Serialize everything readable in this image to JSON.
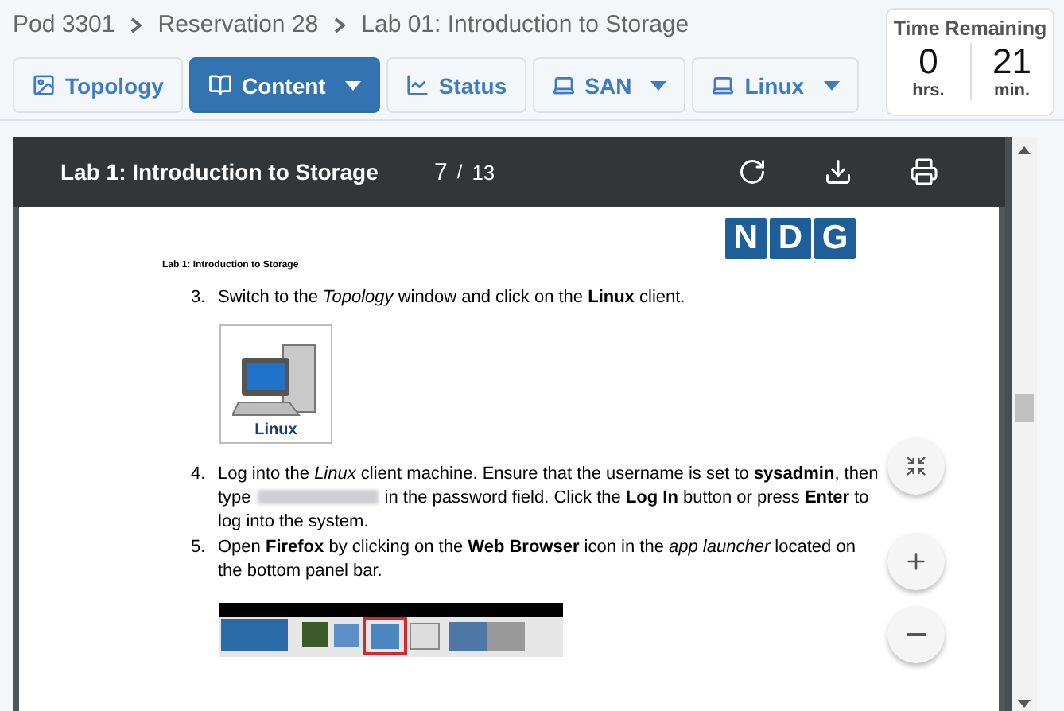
{
  "breadcrumb": [
    "Pod 3301",
    "Reservation 28",
    "Lab 01: Introduction to Storage"
  ],
  "tabs": [
    {
      "label": "Topology",
      "kind": "image",
      "selected": false,
      "dropdown": false
    },
    {
      "label": "Content",
      "kind": "book",
      "selected": true,
      "dropdown": true
    },
    {
      "label": "Status",
      "kind": "chart",
      "selected": false,
      "dropdown": false
    },
    {
      "label": "SAN",
      "kind": "laptop",
      "selected": false,
      "dropdown": true
    },
    {
      "label": "Linux",
      "kind": "laptop",
      "selected": false,
      "dropdown": true
    }
  ],
  "timer": {
    "title": "Time Remaining",
    "hours": "0",
    "hours_unit": "hrs.",
    "minutes": "21",
    "minutes_unit": "min."
  },
  "viewer": {
    "title": "Lab 1: Introduction to Storage",
    "page": "7",
    "separator": "/",
    "page_count": "13"
  },
  "document": {
    "logo": [
      "N",
      "D",
      "G"
    ],
    "running_header": "Lab 1:  Introduction to Storage",
    "steps": [
      {
        "kind": "text",
        "number": "3.",
        "lines": [
          "Switch to the *Topology* window and click on the **Linux** client."
        ]
      },
      {
        "kind": "client-image",
        "caption": "Linux"
      },
      {
        "kind": "text",
        "number": "4.",
        "lines": [
          "Log into the *Linux* client machine.  Ensure that the username is set to **sysadmin**, then type",
          "in the password field.  Click the **Log In** button or press **Enter** to log into the system."
        ]
      },
      {
        "kind": "text",
        "number": "5.",
        "lines": [
          "Open **Firefox** by clicking on the **Web Browser** icon in the *app launcher* located on the bottom panel bar."
        ]
      },
      {
        "kind": "panel-image"
      }
    ]
  }
}
